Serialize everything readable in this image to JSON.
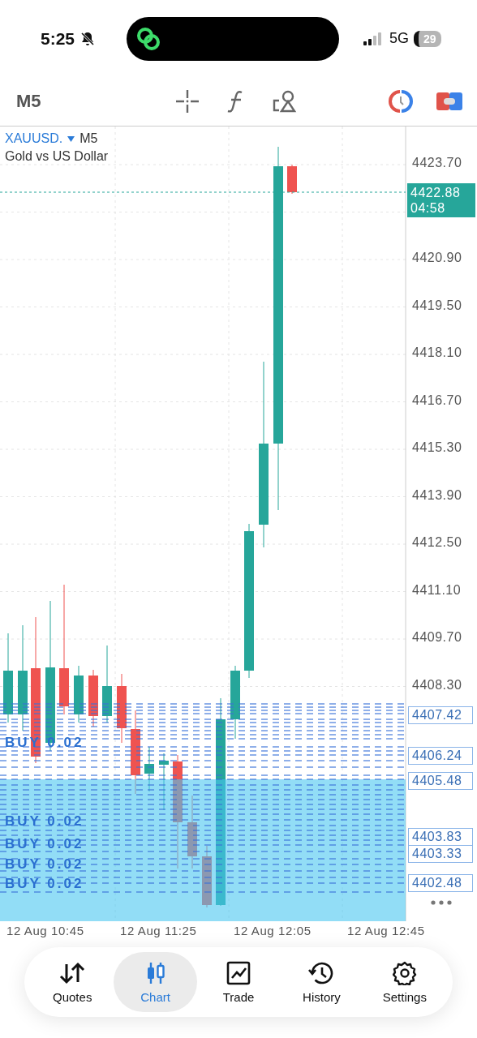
{
  "status_bar": {
    "time": "5:25",
    "network": "5G",
    "battery": "29"
  },
  "toolbar": {
    "timeframe": "M5"
  },
  "chart": {
    "symbol": "XAUUSD.",
    "timeframe": "M5",
    "description": "Gold vs US Dollar",
    "price_ticks": [
      "4423.70",
      "4420.90",
      "4419.50",
      "4418.10",
      "4416.70",
      "4415.30",
      "4413.90",
      "4412.50",
      "4411.10",
      "4409.70",
      "4408.30"
    ],
    "current_price": {
      "price": "4422.88",
      "countdown": "04:58"
    },
    "order_prices": [
      "4407.42",
      "4406.24",
      "4405.48",
      "4403.83",
      "4403.33",
      "4402.48"
    ],
    "order_labels": [
      "BUY 0.02",
      "BUY 0.02",
      "BUY 0.02",
      "BUY 0.02",
      "BUY 0.02"
    ],
    "time_ticks": [
      "12 Aug 10:45",
      "12 Aug 11:25",
      "12 Aug 12:05",
      "12 Aug 12:45"
    ]
  },
  "tabs": [
    {
      "label": "Quotes",
      "selected": false
    },
    {
      "label": "Chart",
      "selected": true
    },
    {
      "label": "Trade",
      "selected": false
    },
    {
      "label": "History",
      "selected": false
    },
    {
      "label": "Settings",
      "selected": false
    }
  ]
}
